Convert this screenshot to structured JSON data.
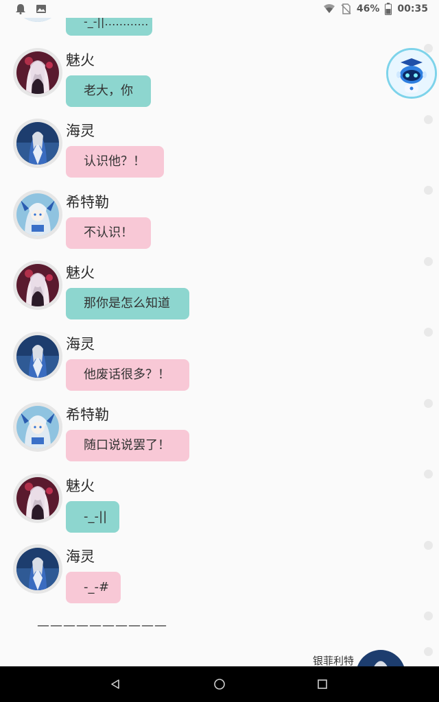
{
  "status_bar": {
    "battery": "46%",
    "time": "00:35",
    "icons": [
      "notification-icon",
      "gallery-icon",
      "wifi-icon",
      "no-sim-icon",
      "battery-icon"
    ]
  },
  "chat": {
    "top_partial_text": "-_-||…………",
    "messages": [
      {
        "name": "魅火",
        "text": "老大，你",
        "color": "teal"
      },
      {
        "name": "海灵",
        "text": "认识他？！",
        "color": "pink"
      },
      {
        "name": "希特勒",
        "text": "不认识！",
        "color": "pink"
      },
      {
        "name": "魅火",
        "text": "那你是怎么知道",
        "color": "teal"
      },
      {
        "name": "海灵",
        "text": "他废话很多？！",
        "color": "pink"
      },
      {
        "name": "希特勒",
        "text": "随口说说罢了！",
        "color": "pink"
      },
      {
        "name": "魅火",
        "text": "-_-||",
        "color": "teal"
      },
      {
        "name": "海灵",
        "text": "-_-#",
        "color": "pink"
      }
    ],
    "divider": "——————————",
    "bottom_right_name": "银菲利特"
  },
  "colors": {
    "teal_bubble": "#8dd6cf",
    "pink_bubble": "#f8c8d6",
    "background": "#fafafa",
    "nav_bar": "#000000"
  },
  "nav": {
    "buttons": [
      "back-icon",
      "home-icon",
      "recents-icon"
    ]
  }
}
